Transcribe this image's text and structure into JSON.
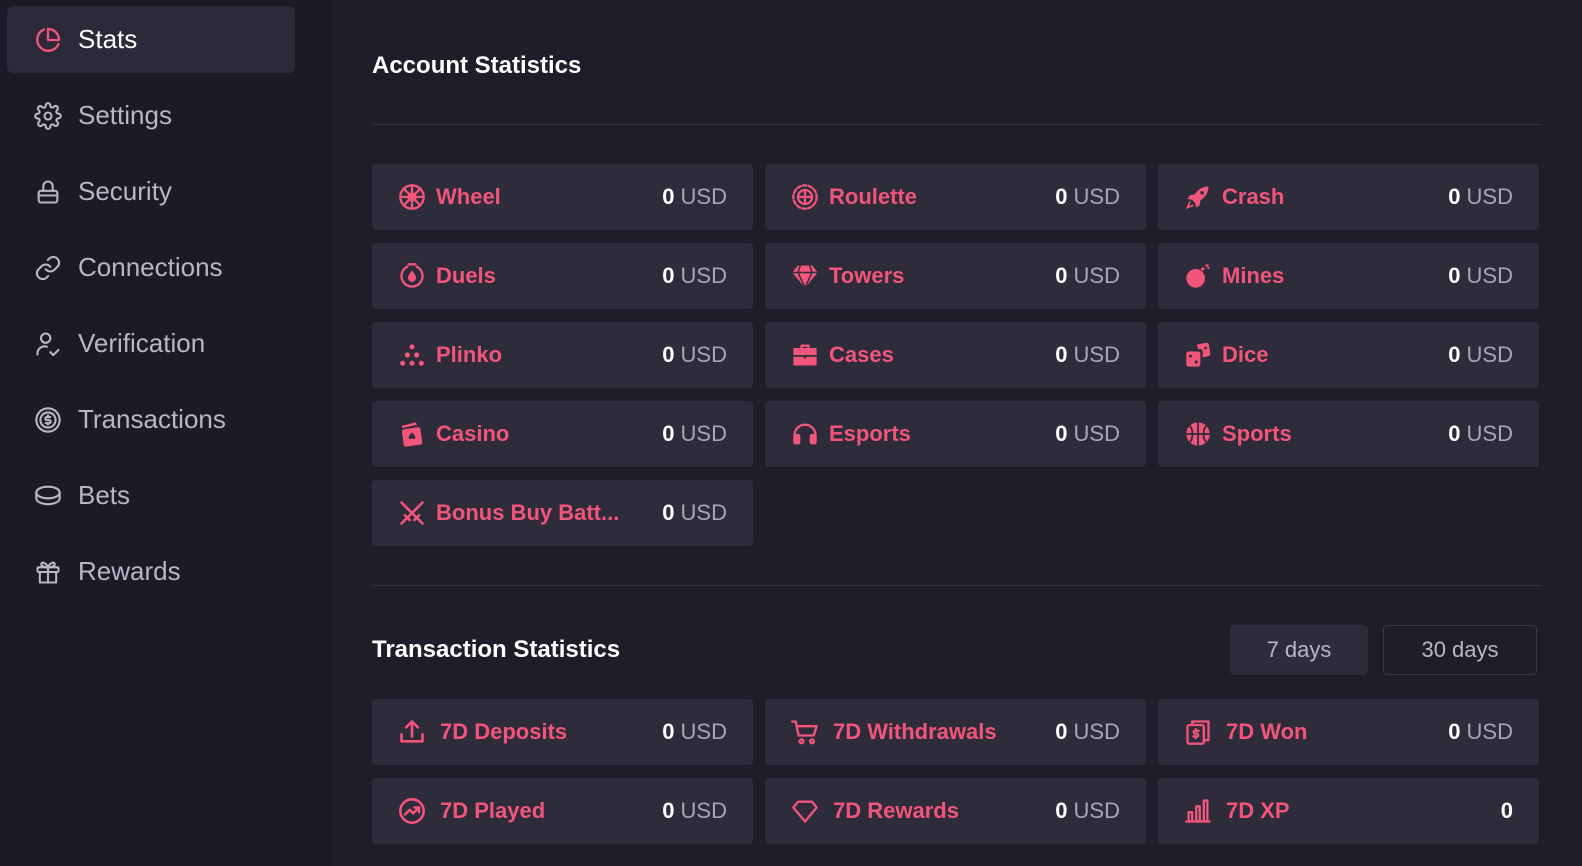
{
  "colors": {
    "accent": "#f2557a",
    "background": "#201d2b",
    "card": "#2e2b3a"
  },
  "sidebar": {
    "items": [
      {
        "label": "Stats",
        "icon": "pie-chart-icon",
        "active": true
      },
      {
        "label": "Settings",
        "icon": "gear-icon"
      },
      {
        "label": "Security",
        "icon": "lock-icon"
      },
      {
        "label": "Connections",
        "icon": "link-icon"
      },
      {
        "label": "Verification",
        "icon": "user-check-icon"
      },
      {
        "label": "Transactions",
        "icon": "dollar-coin-icon"
      },
      {
        "label": "Bets",
        "icon": "coin-stack-icon"
      },
      {
        "label": "Rewards",
        "icon": "gift-icon"
      }
    ]
  },
  "account": {
    "title": "Account Statistics",
    "games": [
      {
        "name": "Wheel",
        "value": "0",
        "currency": "USD",
        "icon": "wheel-icon"
      },
      {
        "name": "Roulette",
        "value": "0",
        "currency": "USD",
        "icon": "roulette-icon"
      },
      {
        "name": "Crash",
        "value": "0",
        "currency": "USD",
        "icon": "rocket-icon"
      },
      {
        "name": "Duels",
        "value": "0",
        "currency": "USD",
        "icon": "duels-icon"
      },
      {
        "name": "Towers",
        "value": "0",
        "currency": "USD",
        "icon": "diamond-icon"
      },
      {
        "name": "Mines",
        "value": "0",
        "currency": "USD",
        "icon": "bomb-icon"
      },
      {
        "name": "Plinko",
        "value": "0",
        "currency": "USD",
        "icon": "plinko-icon"
      },
      {
        "name": "Cases",
        "value": "0",
        "currency": "USD",
        "icon": "briefcase-icon"
      },
      {
        "name": "Dice",
        "value": "0",
        "currency": "USD",
        "icon": "dice-icon"
      },
      {
        "name": "Casino",
        "value": "0",
        "currency": "USD",
        "icon": "cards-icon"
      },
      {
        "name": "Esports",
        "value": "0",
        "currency": "USD",
        "icon": "headset-icon"
      },
      {
        "name": "Sports",
        "value": "0",
        "currency": "USD",
        "icon": "basketball-icon"
      },
      {
        "name": "Bonus Buy Batt...",
        "value": "0",
        "currency": "USD",
        "icon": "crossed-swords-icon"
      }
    ]
  },
  "transactions": {
    "title": "Transaction Statistics",
    "periods": [
      {
        "label": "7 days",
        "selected": true
      },
      {
        "label": "30 days",
        "selected": false
      }
    ],
    "items": [
      {
        "name": "7D Deposits",
        "value": "0",
        "currency": "USD",
        "icon": "upload-icon"
      },
      {
        "name": "7D Withdrawals",
        "value": "0",
        "currency": "USD",
        "icon": "cart-icon"
      },
      {
        "name": "7D Won",
        "value": "0",
        "currency": "USD",
        "icon": "money-icon"
      },
      {
        "name": "7D Played",
        "value": "0",
        "currency": "USD",
        "icon": "trend-up-icon"
      },
      {
        "name": "7D Rewards",
        "value": "0",
        "currency": "USD",
        "icon": "gem-outline-icon"
      },
      {
        "name": "7D XP",
        "value": "0",
        "currency": "",
        "icon": "bar-chart-icon"
      }
    ]
  }
}
